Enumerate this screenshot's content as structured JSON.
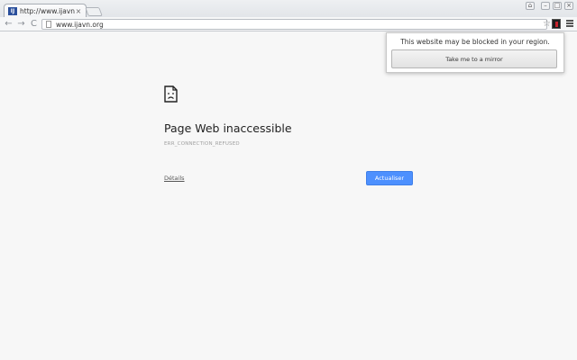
{
  "tab": {
    "title": "http://www.ijavn.org",
    "close_glyph": "×",
    "favicon_text": "IJ"
  },
  "window": {
    "user_glyph": "⌂",
    "minimize_glyph": "–",
    "maximize_glyph": "□",
    "close_glyph": "×"
  },
  "toolbar": {
    "back_glyph": "←",
    "forward_glyph": "→",
    "reload_glyph": "C",
    "url": "www.ijavn.org",
    "star_glyph": "☆"
  },
  "popup": {
    "message": "This website may be blocked in your region.",
    "button_label": "Take me to a mirror"
  },
  "error_page": {
    "title": "Page Web inaccessible",
    "code": "ERR_CONNECTION_REFUSED",
    "details_label": "Détails",
    "reload_label": "Actualiser"
  },
  "colors": {
    "accent": "#4d90fe",
    "page_background": "#f7f7f7"
  },
  "icons": {
    "sad_page": "sad-page-icon",
    "extension": "extension-icon",
    "menu": "hamburger-menu-icon"
  }
}
